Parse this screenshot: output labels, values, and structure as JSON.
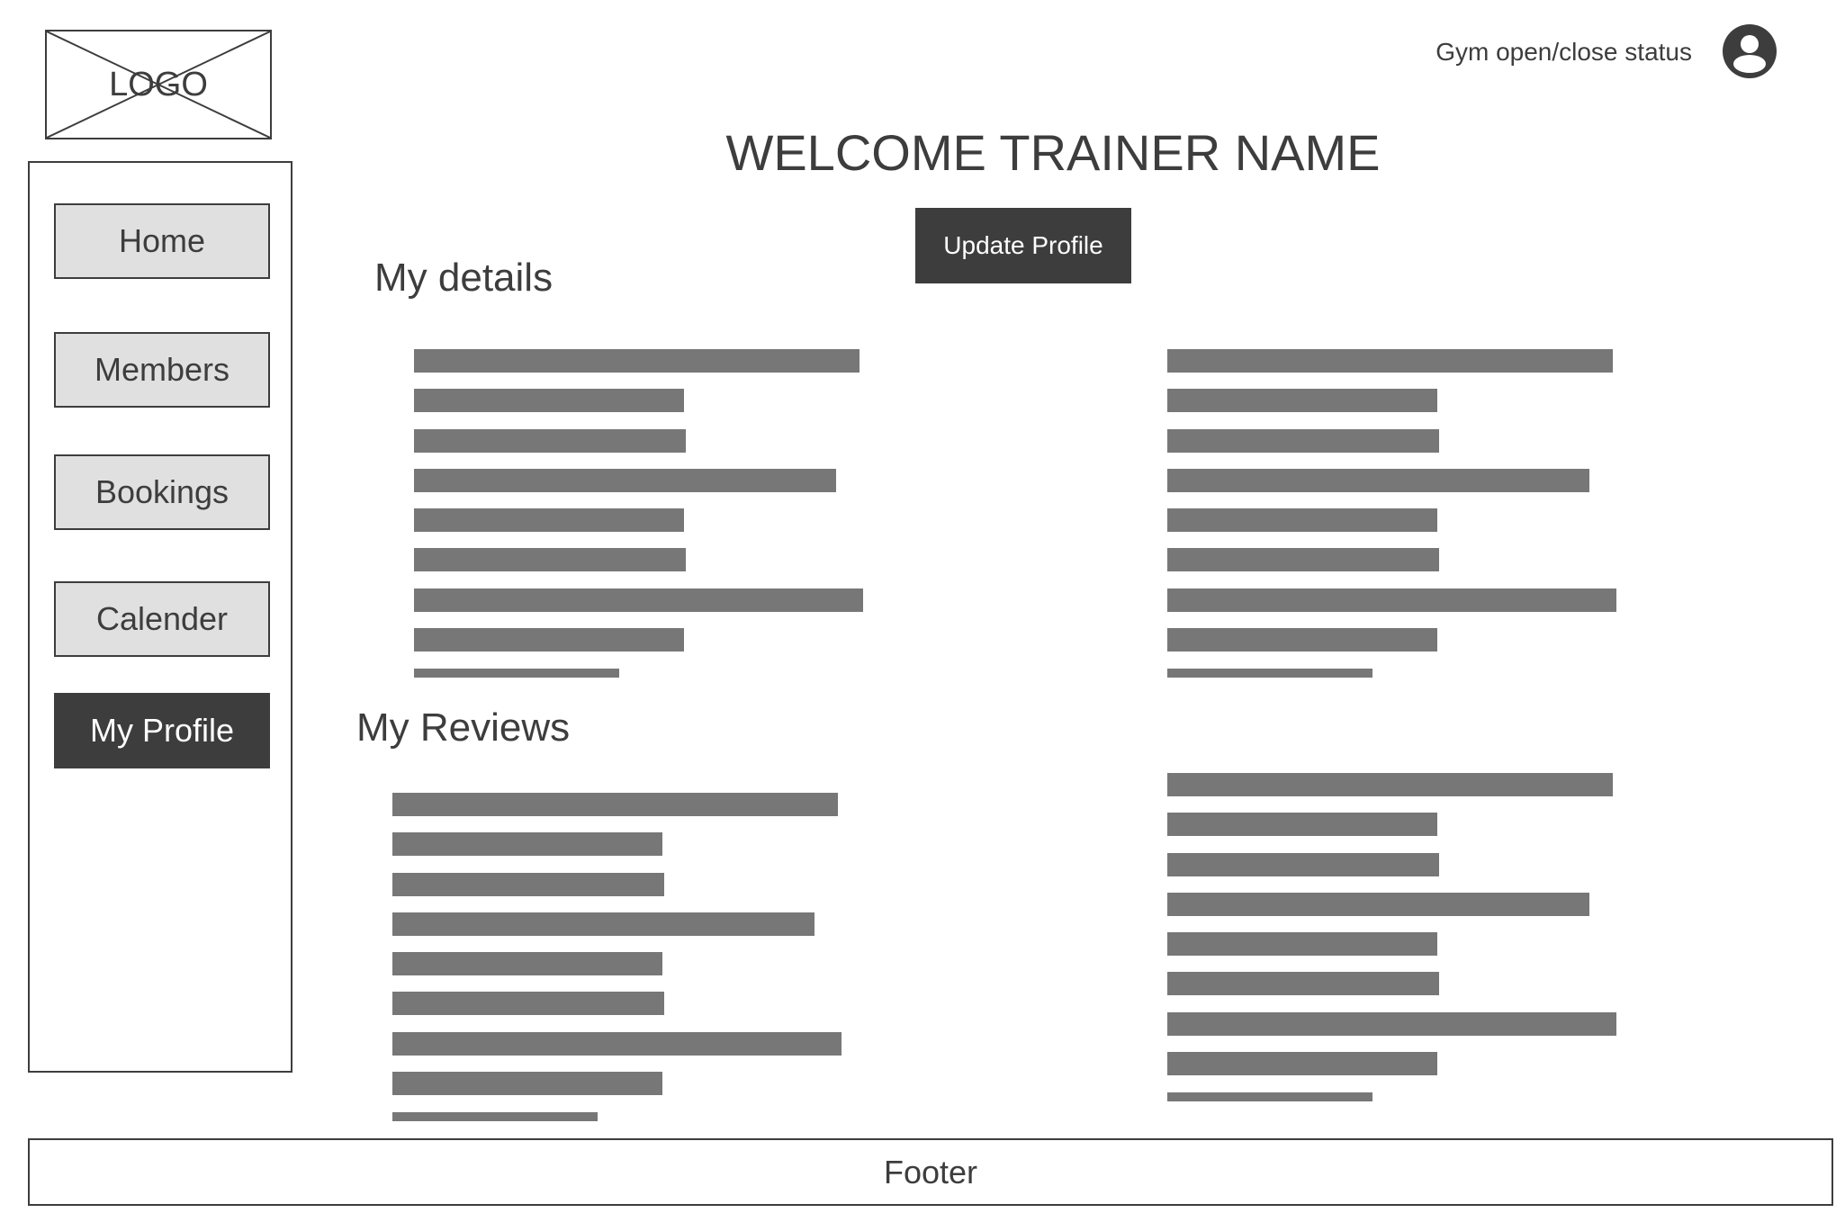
{
  "header": {
    "logo_label": "LOGO",
    "status_text": "Gym open/close status",
    "avatar_icon": "user-avatar-icon"
  },
  "sidebar": {
    "items": [
      {
        "label": "Home",
        "active": false
      },
      {
        "label": "Members",
        "active": false
      },
      {
        "label": "Bookings",
        "active": false
      },
      {
        "label": "Calender",
        "active": false
      },
      {
        "label": "My Profile",
        "active": true
      }
    ]
  },
  "main": {
    "welcome": "WELCOME TRAINER NAME",
    "update_button": "Update Profile",
    "details_title": "My details",
    "reviews_title": "My Reviews"
  },
  "footer": {
    "label": "Footer"
  },
  "colors": {
    "dark": "#3d3d3d",
    "nav_bg": "#e0e0e0",
    "placeholder_bar": "#777777"
  }
}
